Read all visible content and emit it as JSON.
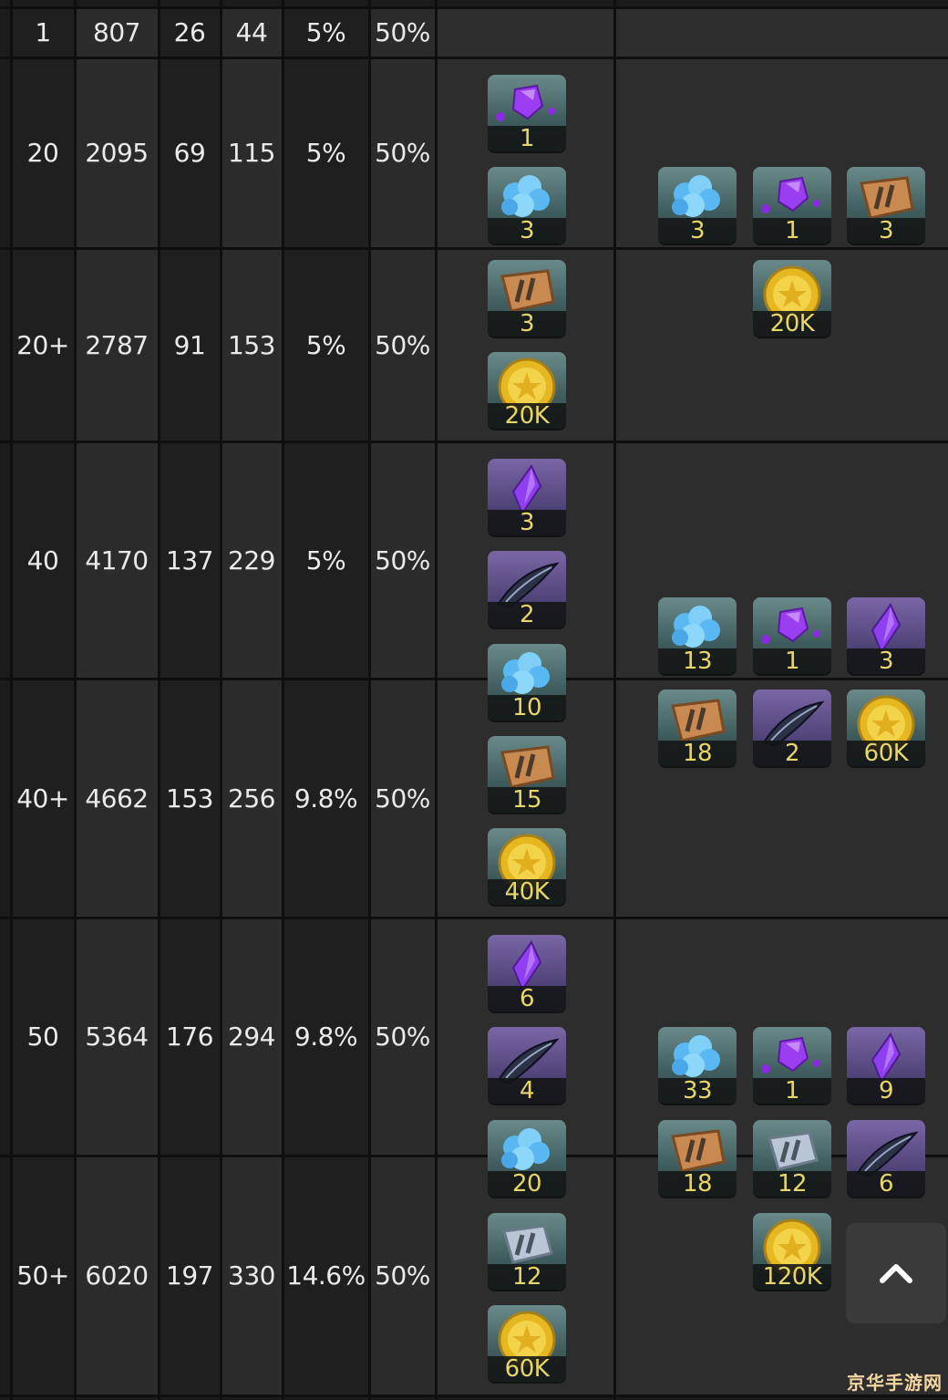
{
  "top_row": [
    "1",
    "807",
    "26",
    "44",
    "5%",
    "50%"
  ],
  "rows": [
    {
      "level": "20",
      "c1": "2095",
      "c2": "69",
      "c3": "115",
      "c4": "5%",
      "c5": "50%"
    },
    {
      "level": "20+",
      "c1": "2787",
      "c2": "91",
      "c3": "153",
      "c4": "5%",
      "c5": "50%"
    },
    {
      "level": "40",
      "c1": "4170",
      "c2": "137",
      "c3": "229",
      "c4": "5%",
      "c5": "50%"
    },
    {
      "level": "40+",
      "c1": "4662",
      "c2": "153",
      "c3": "256",
      "c4": "9.8%",
      "c5": "50%"
    },
    {
      "level": "50",
      "c1": "5364",
      "c2": "176",
      "c3": "294",
      "c4": "9.8%",
      "c5": "50%"
    },
    {
      "level": "50+",
      "c1": "6020",
      "c2": "197",
      "c3": "330",
      "c4": "14.6%",
      "c5": "50%"
    }
  ],
  "groups": [
    {
      "step_items": [
        {
          "icon": "purple-gem-icon",
          "qty": "1"
        },
        {
          "icon": "blue-crystal-icon",
          "qty": "3"
        },
        {
          "icon": "bronze-rune-icon",
          "qty": "3"
        },
        {
          "icon": "gold-coin-icon",
          "qty": "20K"
        }
      ],
      "total_items": [
        {
          "icon": "blue-crystal-icon",
          "qty": "3"
        },
        {
          "icon": "purple-gem-icon",
          "qty": "1"
        },
        {
          "icon": "bronze-rune-icon",
          "qty": "3"
        },
        {
          "icon": "gold-coin-icon",
          "qty": "20K"
        }
      ]
    },
    {
      "step_items": [
        {
          "icon": "purple-shard-icon",
          "qty": "3"
        },
        {
          "icon": "dark-feather-icon",
          "qty": "2"
        },
        {
          "icon": "blue-crystal-icon",
          "qty": "10"
        },
        {
          "icon": "bronze-rune-icon",
          "qty": "15"
        },
        {
          "icon": "gold-coin-icon",
          "qty": "40K"
        }
      ],
      "total_items": [
        {
          "icon": "blue-crystal-icon",
          "qty": "13"
        },
        {
          "icon": "purple-gem-icon",
          "qty": "1"
        },
        {
          "icon": "purple-shard-icon",
          "qty": "3"
        },
        {
          "icon": "bronze-rune-icon",
          "qty": "18"
        },
        {
          "icon": "dark-feather-icon",
          "qty": "2"
        },
        {
          "icon": "gold-coin-icon",
          "qty": "60K"
        }
      ]
    },
    {
      "step_items": [
        {
          "icon": "purple-shard-icon",
          "qty": "6"
        },
        {
          "icon": "dark-feather-icon",
          "qty": "4"
        },
        {
          "icon": "blue-crystal-icon",
          "qty": "20"
        },
        {
          "icon": "silver-rune-icon",
          "qty": "12"
        },
        {
          "icon": "gold-coin-icon",
          "qty": "60K"
        }
      ],
      "total_items": [
        {
          "icon": "blue-crystal-icon",
          "qty": "33"
        },
        {
          "icon": "purple-gem-icon",
          "qty": "1"
        },
        {
          "icon": "purple-shard-icon",
          "qty": "9"
        },
        {
          "icon": "bronze-rune-icon",
          "qty": "18"
        },
        {
          "icon": "silver-rune-icon",
          "qty": "12"
        },
        {
          "icon": "dark-feather-icon",
          "qty": "6"
        },
        {
          "icon": "gold-coin-icon",
          "qty": "120K"
        }
      ]
    }
  ],
  "scroll_top_icon": "chevron-up-icon",
  "watermark": "京华手游网",
  "colors": {
    "qty_text": "#e7d66a",
    "cell_text": "#eaeaea",
    "panel_dark": "#1f1f1f",
    "panel_mid": "#2b2b2b"
  }
}
